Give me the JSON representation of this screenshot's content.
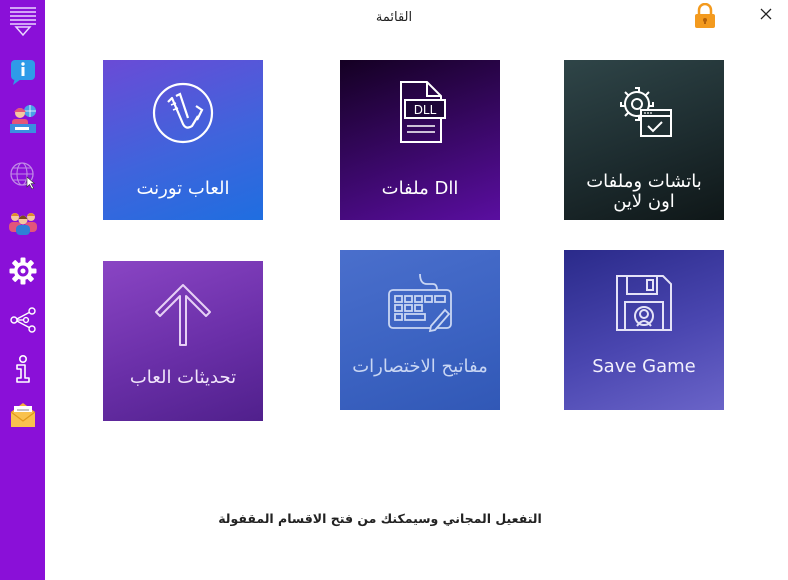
{
  "window": {
    "title": "القائمة"
  },
  "sidebar": {
    "items": [
      {
        "name": "menu",
        "icon": "hamburger-menu-icon"
      },
      {
        "name": "info",
        "icon": "info-chat-icon"
      },
      {
        "name": "news",
        "icon": "news-presenter-icon"
      },
      {
        "name": "web",
        "icon": "globe-cursor-icon"
      },
      {
        "name": "community",
        "icon": "users-group-icon"
      },
      {
        "name": "settings",
        "icon": "gear-icon"
      },
      {
        "name": "share",
        "icon": "share-icon"
      },
      {
        "name": "about",
        "icon": "info-icon"
      },
      {
        "name": "mail",
        "icon": "envelope-icon"
      }
    ]
  },
  "tiles": {
    "torrent": {
      "label": "العاب تورنت",
      "icon": "torrent-magnet-icon"
    },
    "dll": {
      "label": "ملفات Dll",
      "icon": "dll-file-icon",
      "icon_text": "DLL"
    },
    "patches": {
      "label": "باتشات وملفات اون لاين",
      "icon": "gear-settings-window-icon"
    },
    "updates": {
      "label": "تحديثات العاب",
      "icon": "arrow-up-icon"
    },
    "shortcuts": {
      "label": "مفاتيح الاختصارات",
      "icon": "keyboard-icon"
    },
    "savegame": {
      "label": "Save Game",
      "icon": "floppy-disk-icon"
    }
  },
  "footer": {
    "text": "التفعيل المجاني وسيمكنك من فتح الاقسام المقفولة"
  },
  "colors": {
    "sidebar": "#8a10d8",
    "lock": "#f39a1e"
  }
}
